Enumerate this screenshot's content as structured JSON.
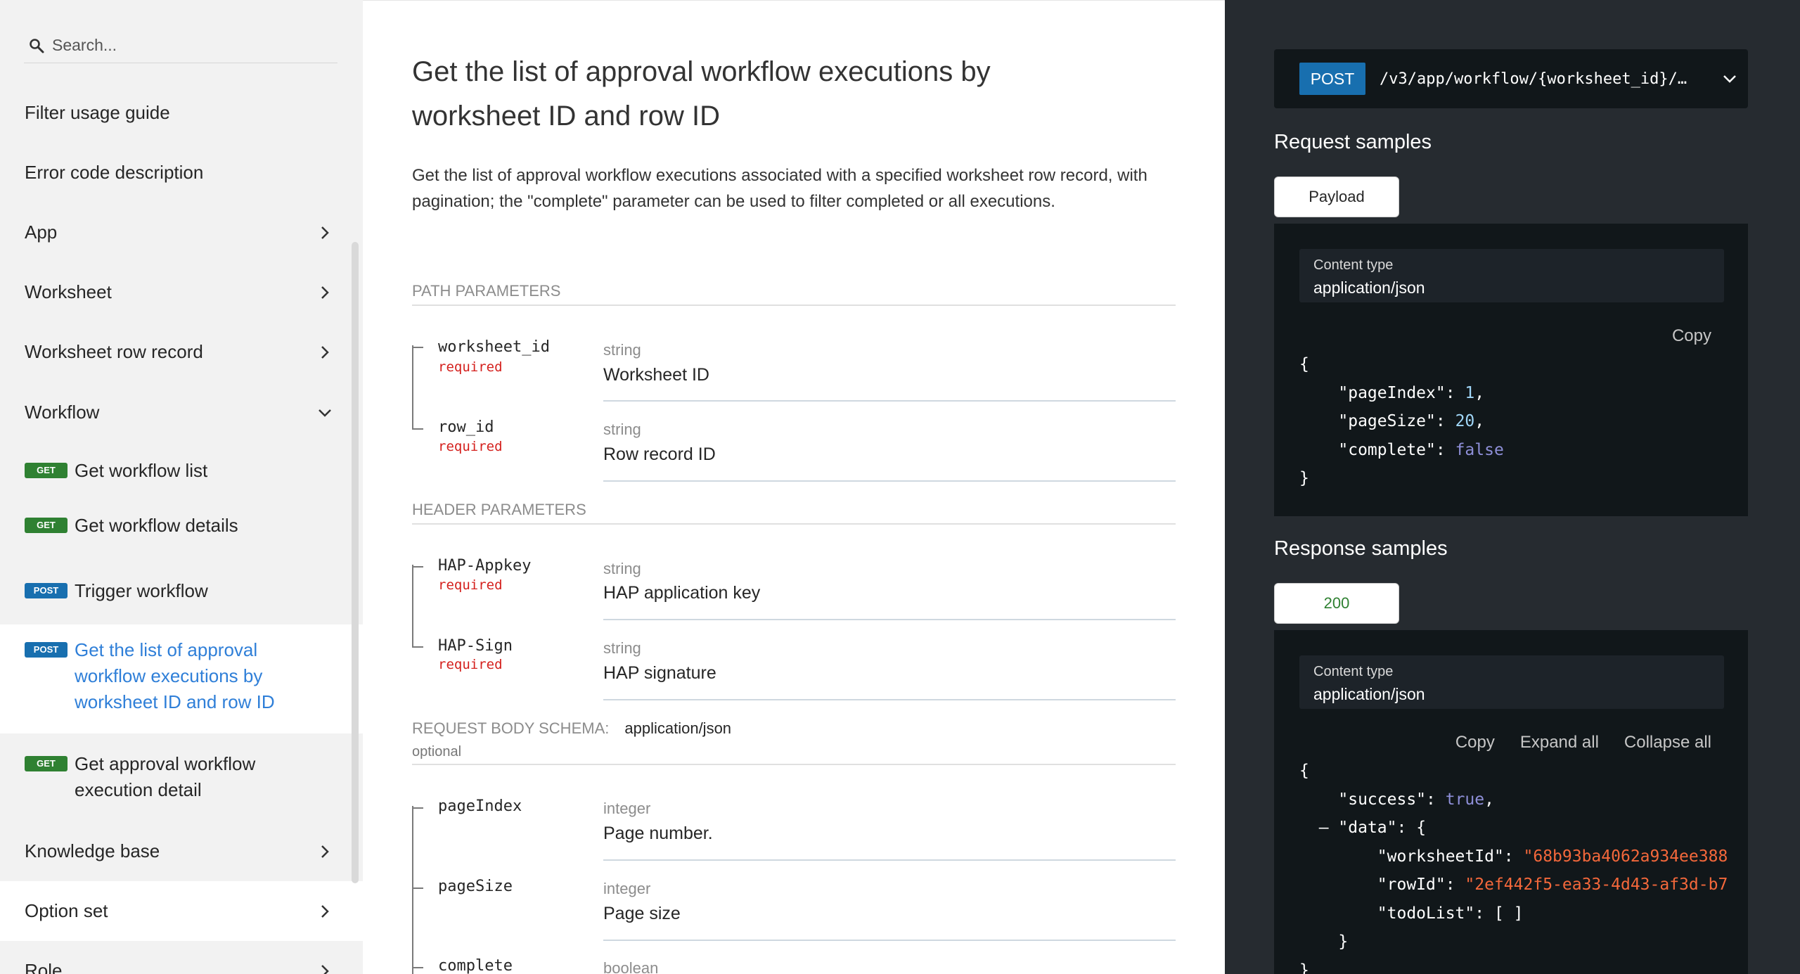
{
  "sidebar": {
    "search_placeholder": "Search...",
    "items": [
      {
        "label": "Filter usage guide"
      },
      {
        "label": "Error code description"
      },
      {
        "label": "App"
      },
      {
        "label": "Worksheet"
      },
      {
        "label": "Worksheet row record"
      },
      {
        "label": "Workflow"
      }
    ],
    "workflow_children": [
      {
        "method": "GET",
        "label": "Get workflow list"
      },
      {
        "method": "GET",
        "label": "Get workflow details"
      },
      {
        "method": "POST",
        "label": "Trigger workflow"
      },
      {
        "method": "POST",
        "label": "Get the list of approval workflow executions by worksheet ID and row ID"
      },
      {
        "method": "GET",
        "label": "Get approval workflow execution detail"
      }
    ],
    "bottom_items": [
      {
        "label": "Knowledge base"
      },
      {
        "label": "Option set"
      },
      {
        "label": "Role"
      }
    ]
  },
  "main": {
    "title": "Get the list of approval workflow executions by worksheet ID and row ID",
    "description": "Get the list of approval workflow executions associated with a specified worksheet row record, with pagination; the \"complete\" parameter can be used to filter completed or all executions.",
    "path_params_heading": "PATH PARAMETERS",
    "header_params_heading": "HEADER PARAMETERS",
    "body_schema_heading": "REQUEST BODY SCHEMA:",
    "body_schema_mime": "application/json",
    "body_optional": "optional",
    "required_label": "required",
    "path_params": [
      {
        "name": "worksheet_id",
        "type": "string",
        "desc": "Worksheet ID"
      },
      {
        "name": "row_id",
        "type": "string",
        "desc": "Row record ID"
      }
    ],
    "header_params": [
      {
        "name": "HAP-Appkey",
        "type": "string",
        "desc": "HAP application key"
      },
      {
        "name": "HAP-Sign",
        "type": "string",
        "desc": "HAP signature"
      }
    ],
    "body_params": [
      {
        "name": "pageIndex",
        "type": "integer",
        "desc": "Page number."
      },
      {
        "name": "pageSize",
        "type": "integer",
        "desc": "Page size"
      },
      {
        "name": "complete",
        "type": "boolean"
      }
    ]
  },
  "panel": {
    "method": "POST",
    "path": "/v3/app/workflow/{worksheet_id}/…",
    "request_title": "Request samples",
    "request_tab": "Payload",
    "content_type_label": "Content type",
    "content_type_value": "application/json",
    "copy": "Copy",
    "expand_all": "Expand all",
    "collapse_all": "Collapse all",
    "response_title": "Response samples",
    "response_tab": "200",
    "request_body": {
      "pageIndex_key": "\"pageIndex\"",
      "pageIndex_val": "1",
      "pageSize_key": "\"pageSize\"",
      "pageSize_val": "20",
      "complete_key": "\"complete\"",
      "complete_val": "false"
    },
    "response_body": {
      "success_key": "\"success\"",
      "success_val": "true",
      "data_key": "\"data\"",
      "worksheetId_key": "\"worksheetId\"",
      "worksheetId_val": "\"68b93ba4062a934ee388",
      "rowId_key": "\"rowId\"",
      "rowId_val": "\"2ef442f5-ea33-4d43-af3d-b7",
      "todoList_key": "\"todoList\"",
      "todoList_val": "[ ]"
    },
    "colors": {
      "post": "#186faf",
      "get": "#2f8132",
      "required": "#d41f1c",
      "link": "#2f7fd8"
    }
  }
}
